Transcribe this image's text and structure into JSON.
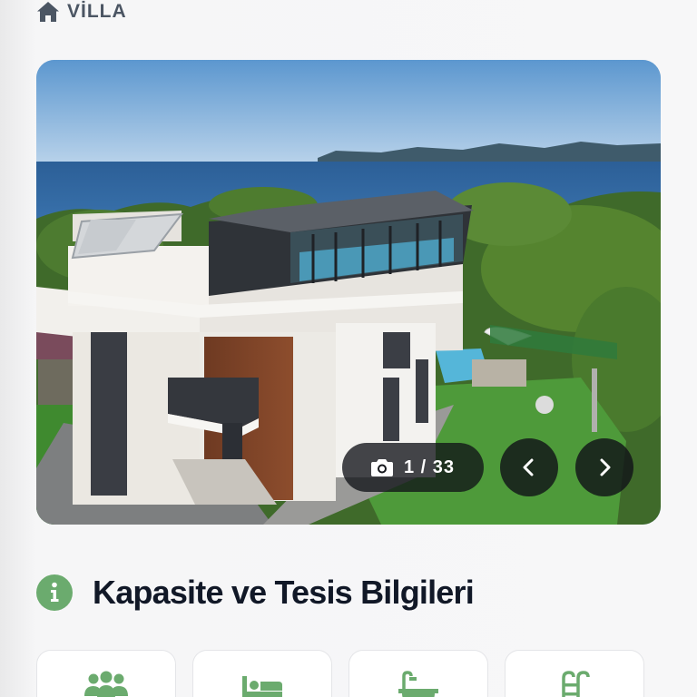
{
  "breadcrumb": {
    "icon": "home-icon",
    "label": "VİLLA"
  },
  "gallery": {
    "current": "1",
    "separator": "/",
    "total": "33",
    "counter_text": "1 / 33",
    "icons": {
      "counter": "camera-icon",
      "prev": "chevron-left-icon",
      "next": "chevron-right-icon"
    }
  },
  "section": {
    "icon": "info-icon",
    "title": "Kapasite ve Tesis Bilgileri"
  },
  "features": [
    {
      "icon": "guests-icon"
    },
    {
      "icon": "bed-icon"
    },
    {
      "icon": "bath-icon"
    },
    {
      "icon": "pool-icon"
    }
  ],
  "colors": {
    "accent_green": "#6bab6e",
    "text_dark": "#111827",
    "breadcrumb_gray": "#4b5563",
    "overlay_dark": "#111318"
  }
}
